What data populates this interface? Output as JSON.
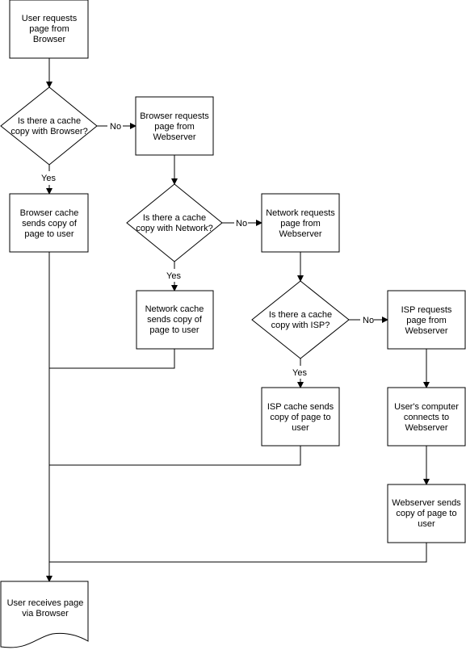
{
  "diagram": {
    "nodes": {
      "user_requests": {
        "type": "process",
        "lines": [
          "User requests",
          "page from",
          "Browser"
        ]
      },
      "browser_cache_q": {
        "type": "decision",
        "lines": [
          "Is there a cache",
          "copy with Browser?"
        ]
      },
      "browser_requests": {
        "type": "process",
        "lines": [
          "Browser requests",
          "page from",
          "Webserver"
        ]
      },
      "browser_cache_sends": {
        "type": "process",
        "lines": [
          "Browser cache",
          "sends copy of",
          "page to user"
        ]
      },
      "network_cache_q": {
        "type": "decision",
        "lines": [
          "Is there a cache",
          "copy with Network?"
        ]
      },
      "network_requests": {
        "type": "process",
        "lines": [
          "Network requests",
          "page from",
          "Webserver"
        ]
      },
      "network_cache_sends": {
        "type": "process",
        "lines": [
          "Network cache",
          "sends copy of",
          "page to user"
        ]
      },
      "isp_cache_q": {
        "type": "decision",
        "lines": [
          "Is there a cache",
          "copy with ISP?"
        ]
      },
      "isp_requests": {
        "type": "process",
        "lines": [
          "ISP requests",
          "page from",
          "Webserver"
        ]
      },
      "isp_cache_sends": {
        "type": "process",
        "lines": [
          "ISP cache sends",
          "copy of page to",
          "user"
        ]
      },
      "user_computer_connects": {
        "type": "process",
        "lines": [
          "User's computer",
          "connects to",
          "Webserver"
        ]
      },
      "webserver_sends": {
        "type": "process",
        "lines": [
          "Webserver sends",
          "copy of page to",
          "user"
        ]
      },
      "user_receives": {
        "type": "document",
        "lines": [
          "User receives page",
          "via Browser"
        ]
      }
    },
    "edge_labels": {
      "yes": "Yes",
      "no": "No"
    },
    "edges": [
      {
        "from": "user_requests",
        "to": "browser_cache_q",
        "label": ""
      },
      {
        "from": "browser_cache_q",
        "to": "browser_requests",
        "label": "No"
      },
      {
        "from": "browser_cache_q",
        "to": "browser_cache_sends",
        "label": "Yes"
      },
      {
        "from": "browser_requests",
        "to": "network_cache_q",
        "label": ""
      },
      {
        "from": "network_cache_q",
        "to": "network_requests",
        "label": "No"
      },
      {
        "from": "network_cache_q",
        "to": "network_cache_sends",
        "label": "Yes"
      },
      {
        "from": "network_requests",
        "to": "isp_cache_q",
        "label": ""
      },
      {
        "from": "isp_cache_q",
        "to": "isp_requests",
        "label": "No"
      },
      {
        "from": "isp_cache_q",
        "to": "isp_cache_sends",
        "label": "Yes"
      },
      {
        "from": "isp_requests",
        "to": "user_computer_connects",
        "label": ""
      },
      {
        "from": "user_computer_connects",
        "to": "webserver_sends",
        "label": ""
      },
      {
        "from": "browser_cache_sends",
        "to": "user_receives",
        "label": ""
      },
      {
        "from": "network_cache_sends",
        "to": "user_receives",
        "label": ""
      },
      {
        "from": "isp_cache_sends",
        "to": "user_receives",
        "label": ""
      },
      {
        "from": "webserver_sends",
        "to": "user_receives",
        "label": ""
      }
    ]
  }
}
